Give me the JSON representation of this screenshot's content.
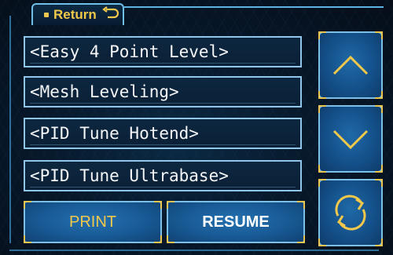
{
  "header": {
    "return_label": "Return",
    "return_icon": "return-arrow-icon"
  },
  "menu": {
    "items": [
      {
        "label": "<Easy 4 Point Level>"
      },
      {
        "label": "<Mesh Leveling>"
      },
      {
        "label": "<PID Tune Hotend>"
      },
      {
        "label": "<PID Tune Ultrabase>"
      }
    ]
  },
  "side_buttons": {
    "up_icon": "chevron-up-icon",
    "down_icon": "chevron-down-icon",
    "refresh_icon": "refresh-icon"
  },
  "actions": {
    "print_label": "PRINT",
    "resume_label": "RESUME"
  },
  "colors": {
    "accent": "#e8c650",
    "frame": "#6fbfe8",
    "button": "#185a95",
    "background": "#07182a",
    "text": "#f4f6f8"
  }
}
